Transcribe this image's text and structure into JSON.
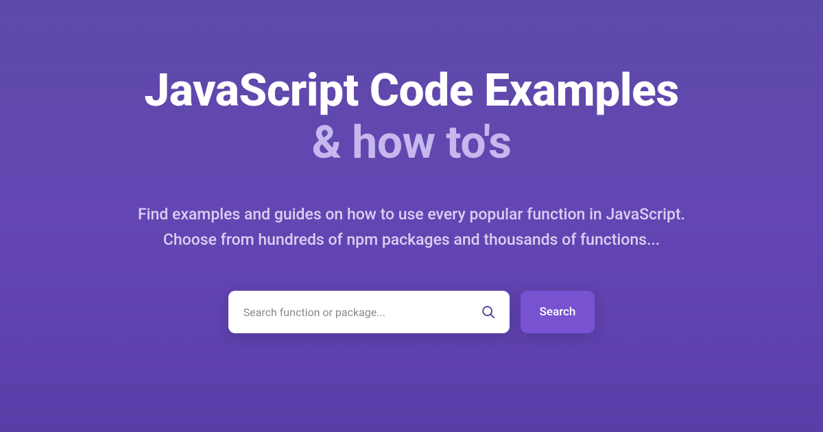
{
  "hero": {
    "title_line1": "JavaScript Code Examples",
    "title_line2": "& how to's",
    "subtitle_line1": "Find examples and guides on how to use every popular function in JavaScript.",
    "subtitle_line2": "Choose from hundreds of npm packages and thousands of functions..."
  },
  "search": {
    "placeholder": "Search function or package...",
    "button_label": "Search"
  }
}
